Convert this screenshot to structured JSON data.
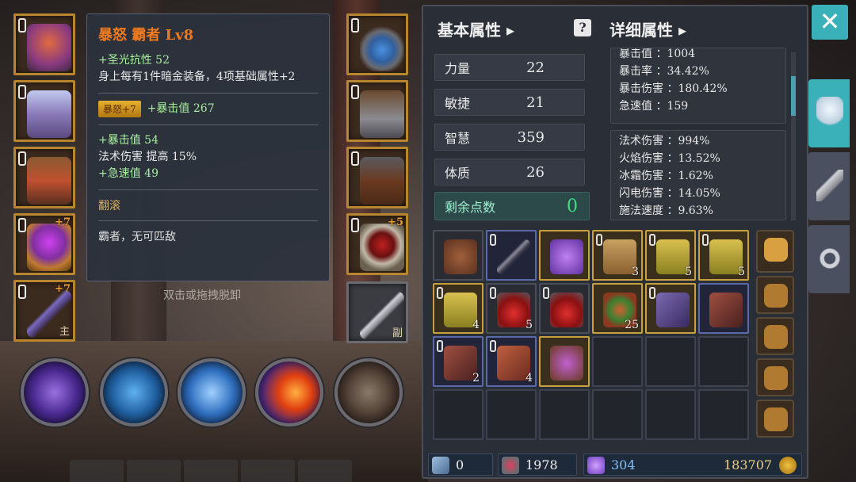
{
  "tooltip": {
    "title": "暴怒 霸者 Lv8",
    "lines_a": [
      "+圣光抗性 52",
      "身上每有1件暗金装备，4项基础属性+2"
    ],
    "badge": "暴怒+7",
    "badge_stat": "+暴击值 267",
    "lines_b": [
      "+暴击值 54",
      "法术伤害 提高 15%",
      "+急速值 49"
    ],
    "skill": "翻滚",
    "desc": "霸者，无可匹敌"
  },
  "hint": "双击或拖拽脱卸",
  "equipment": {
    "ring_plus": "+7",
    "staff_plus": "+7",
    "staff_tag": "主",
    "right_ring_plus": "+5",
    "weapon_tag": "副"
  },
  "panel": {
    "basic_title": "基本属性 ▸",
    "detail_title": "详细属性 ▸",
    "help": "?",
    "stats": [
      {
        "label": "力量",
        "value": "22"
      },
      {
        "label": "敏捷",
        "value": "21"
      },
      {
        "label": "智慧",
        "value": "359"
      },
      {
        "label": "体质",
        "value": "26"
      }
    ],
    "points_label": "剩余点数",
    "points_value": "0",
    "detail_a": [
      "暴击值 ：1004",
      "暴击率 ：34.42%",
      "暴击伤害 ：180.42%",
      "急速值 ：159"
    ],
    "detail_b": [
      "法术伤害 ：994%",
      "火焰伤害 ：13.52%",
      "冰霜伤害 ：1.62%",
      "闪电伤害 ：14.05%",
      "施法速度 ：9.63%"
    ]
  },
  "inventory": {
    "counts": [
      "3",
      "5",
      "5",
      "4",
      "5",
      "25",
      "2",
      "4"
    ]
  },
  "currency": {
    "keys": "0",
    "hearts": "1978",
    "gems": "304",
    "gold": "183707"
  },
  "close_label": "✕"
}
